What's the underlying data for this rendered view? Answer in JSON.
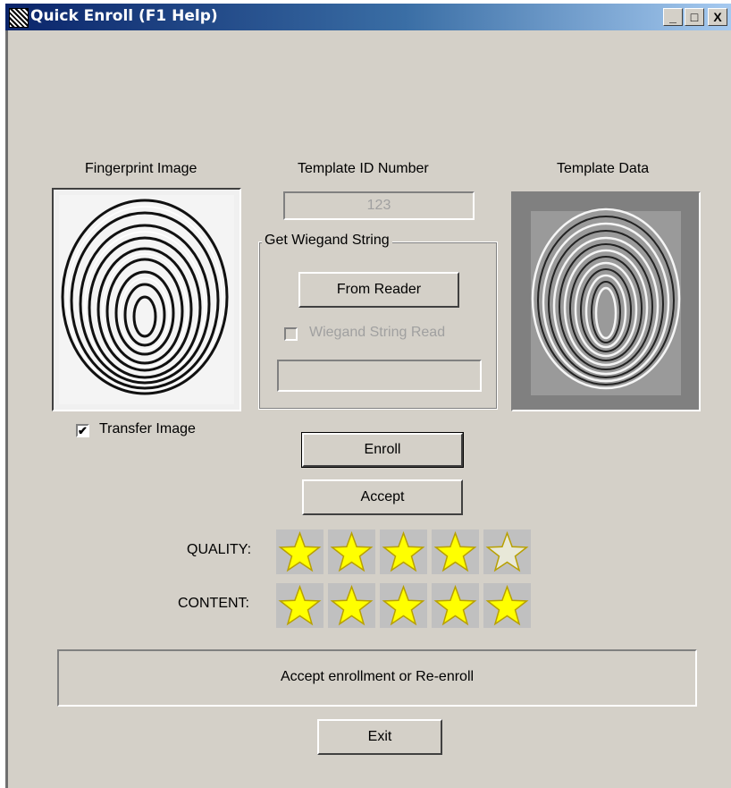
{
  "window": {
    "title": "Quick Enroll (F1 Help)",
    "min": "_",
    "max": "□",
    "close": "X"
  },
  "labels": {
    "fingerprint_image": "Fingerprint Image",
    "template_id_number": "Template ID Number",
    "template_data": "Template Data",
    "get_wiegand": "Get Wiegand String",
    "wiegand_read": "Wiegand String Read",
    "transfer_image": "Transfer Image",
    "quality": "QUALITY:",
    "content": "CONTENT:"
  },
  "fields": {
    "template_id": "123",
    "wiegand_value": ""
  },
  "buttons": {
    "from_reader": "From Reader",
    "enroll": "Enroll",
    "accept": "Accept",
    "exit": "Exit"
  },
  "checkboxes": {
    "transfer_image_checked": true,
    "wiegand_read_checked": false
  },
  "ratings": {
    "quality": 4,
    "content": 5,
    "max": 5
  },
  "status": "Accept enrollment or Re-enroll",
  "colors": {
    "star_fill": "#ffff00",
    "star_outline": "#b8a000",
    "star_empty": "#e8e8d8"
  }
}
